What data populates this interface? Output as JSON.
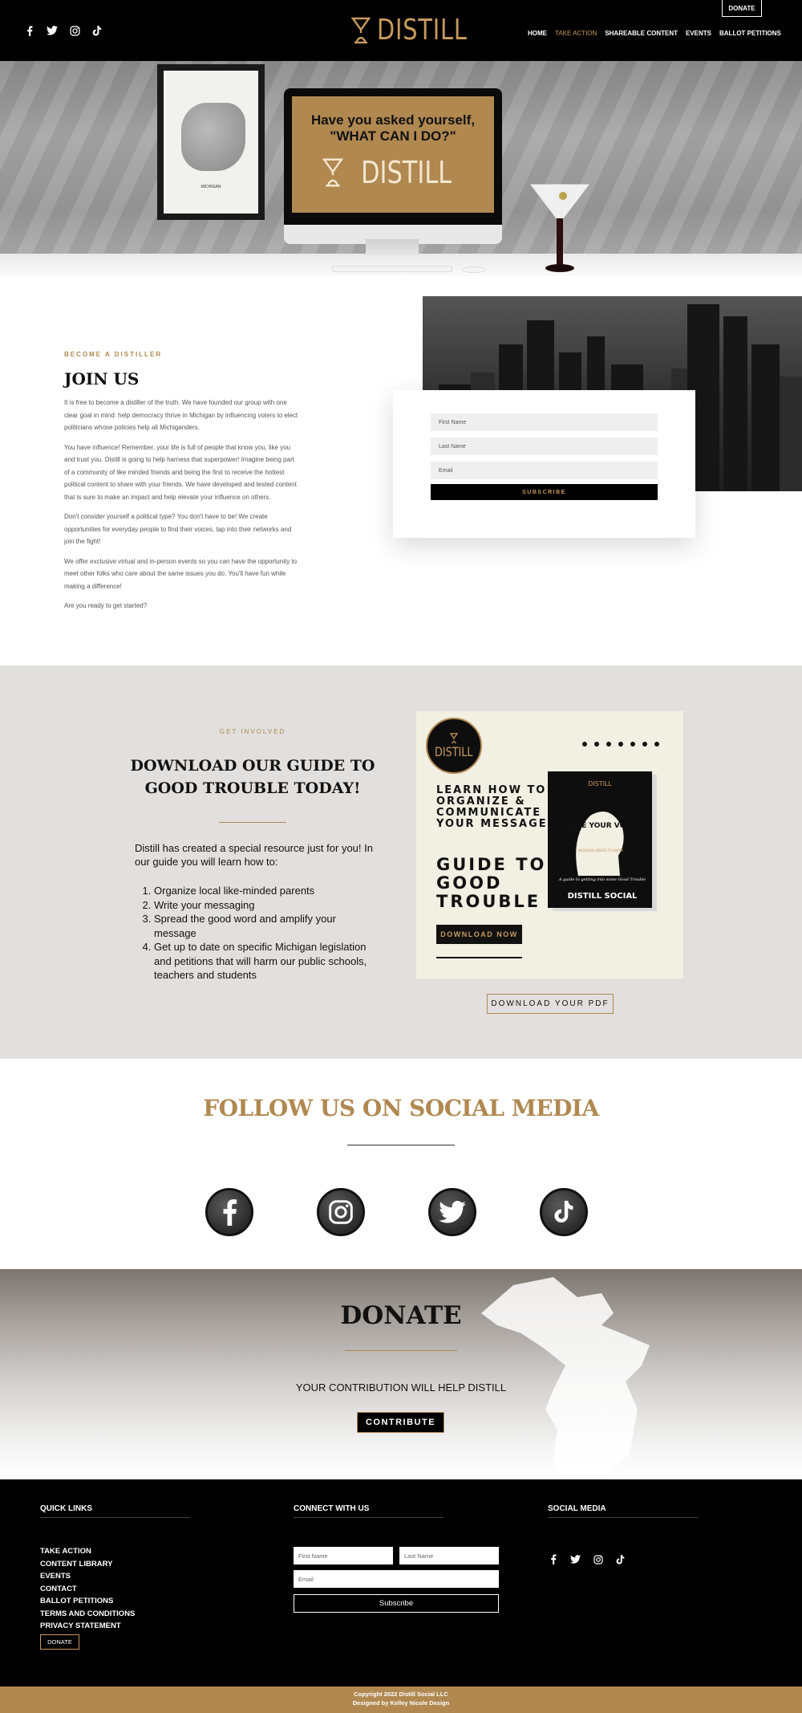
{
  "header": {
    "donate_label": "DONATE",
    "logo_text": "DISTILL",
    "nav": [
      {
        "label": "HOME",
        "active": false
      },
      {
        "label": "TAKE ACTION",
        "active": true
      },
      {
        "label": "SHAREABLE CONTENT",
        "active": false
      },
      {
        "label": "EVENTS",
        "active": false
      },
      {
        "label": "BALLOT PETITIONS",
        "active": false
      }
    ],
    "social_icons": [
      "facebook-icon",
      "twitter-icon",
      "instagram-icon",
      "tiktok-icon"
    ]
  },
  "hero": {
    "screen_line1": "Have you asked yourself,",
    "screen_line2": "\"WHAT CAN I DO?\"",
    "screen_logo": "DISTILL",
    "frame_label": "MICHIGAN"
  },
  "join": {
    "eyebrow": "BECOME A DISTILLER",
    "title": "JOIN US",
    "paragraphs": [
      "It is free to become a distiller of the truth. We have founded our group with one clear goal in mind: help democracy thrive in Michigan by influencing voters to elect politicians whose policies help all Michiganders.",
      "You have influence! Remember, your life is full of people that know you, like you and trust you. Distill is going to help harness that superpower! Imagine being part of a community of like minded friends and being the first to receive the hottest political content to share with your friends.  We have developed and tested content that is sure to make an impact and help elevate your influence on others.",
      "Don't consider yourself a political type?  You don't have to be!  We create opportunities for everyday people to find their voices, tap into their networks and join the fight!",
      "We offer exclusive virtual and in-person events so you can have the opportunity to meet other folks who care about the same issues you do. You'll have fun while making a difference!",
      "Are you ready to get started?"
    ],
    "form": {
      "first_name": "First Name",
      "last_name": "Last Name",
      "email": "Email",
      "subscribe": "SUBSCRIBE"
    }
  },
  "guide": {
    "eyebrow": "GET INVOLVED",
    "title": "DOWNLOAD OUR GUIDE TO GOOD TROUBLE TODAY!",
    "intro": "Distill has created a special resource just for you! In our guide you will learn how to:",
    "items": [
      "Organize local like-minded parents",
      "Write your messaging",
      "Spread the good word and amplify your message",
      "Get up to date on specific Michigan legislation and petitions that will harm our public schools, teachers and students"
    ],
    "poster": {
      "badge": "DISTILL",
      "learn": "LEARN HOW TO ORGANIZE & COMMUNICATE YOUR MESSAGE",
      "headline": "GUIDE TO GOOD TROUBLE",
      "button": "DOWNLOAD NOW",
      "book_brand": "DISTILL",
      "book_raise": "RAISE YOUR VOICE!",
      "book_sub": "MICHIGAN NEEDS TO KNOW",
      "book_tag": "A guide to getting into some Good Trouble",
      "book_footer": "DISTILL SOCIAL"
    },
    "download_label": "DOWNLOAD YOUR PDF"
  },
  "follow": {
    "title": "FOLLOW US ON SOCIAL MEDIA",
    "icons": [
      "facebook-icon",
      "instagram-icon",
      "twitter-icon",
      "tiktok-icon"
    ]
  },
  "donate": {
    "title": "DONATE",
    "subtitle": "YOUR CONTRIBUTION WILL HELP DISTILL",
    "button": "CONTRIBUTE"
  },
  "footer": {
    "quick_links_title": "QUICK LINKS",
    "quick_links": [
      "TAKE ACTION",
      "CONTENT LIBRARY",
      "EVENTS",
      "CONTACT",
      "BALLOT PETITIONS",
      "TERMS AND CONDITIONS",
      "PRIVACY STATEMENT"
    ],
    "donate_label": "DONATE",
    "connect_title": "CONNECT WITH US",
    "first_name": "First Name",
    "last_name": "Last Name",
    "email": "Email",
    "subscribe": "Subscribe",
    "social_title": "SOCIAL MEDIA",
    "copyright": "Copyright 2022 Distill Social LLC",
    "designed_by": "Designed by Kelley Nicole Design"
  },
  "colors": {
    "accent": "#b08850",
    "black": "#000000",
    "guide_bg": "#e1e0de"
  }
}
